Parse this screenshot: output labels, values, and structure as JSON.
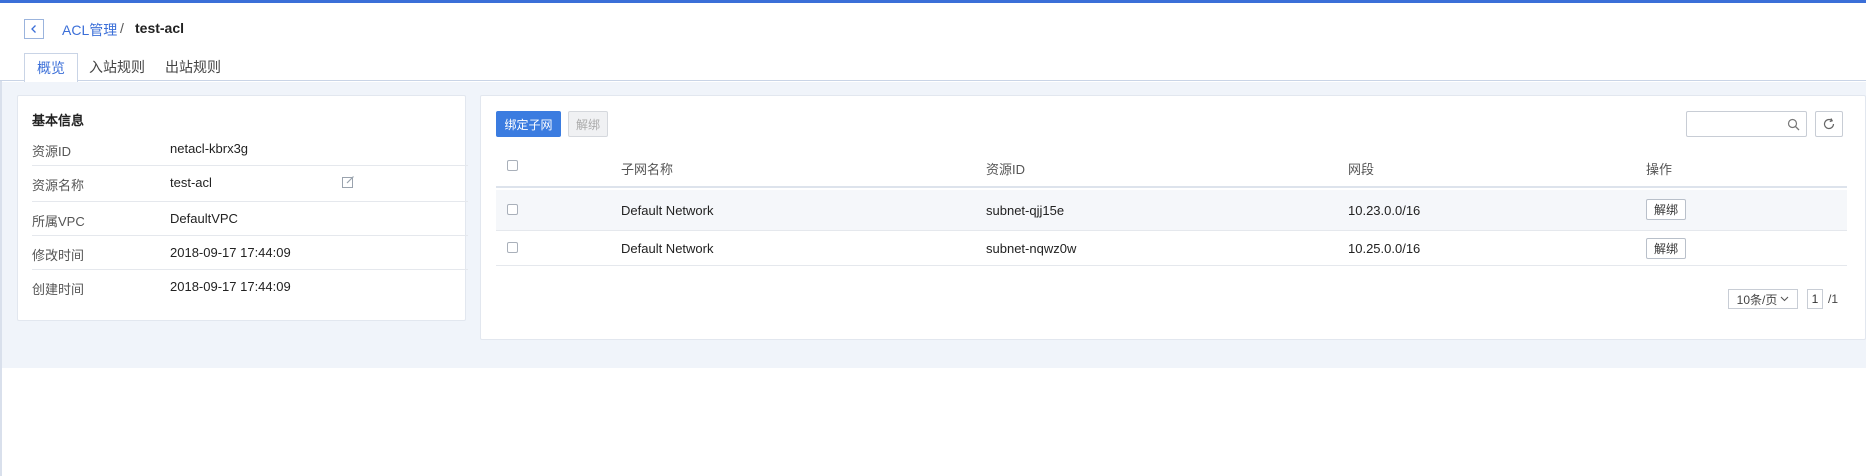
{
  "breadcrumb": {
    "parent": "ACL管理",
    "separator": "/",
    "current": "test-acl"
  },
  "tabs": [
    {
      "label": "概览",
      "active": true
    },
    {
      "label": "入站规则",
      "active": false
    },
    {
      "label": "出站规则",
      "active": false
    }
  ],
  "info": {
    "title": "基本信息",
    "rows": [
      {
        "label": "资源ID",
        "value": "netacl-kbrx3g"
      },
      {
        "label": "资源名称",
        "value": "test-acl"
      },
      {
        "label": "所属VPC",
        "value": "DefaultVPC"
      },
      {
        "label": "修改时间",
        "value": "2018-09-17 17:44:09"
      },
      {
        "label": "创建时间",
        "value": "2018-09-17 17:44:09"
      }
    ]
  },
  "toolbar": {
    "bind_label": "绑定子网",
    "unbind_label": "解绑",
    "search_placeholder": ""
  },
  "table": {
    "columns": [
      "子网名称",
      "资源ID",
      "网段",
      "操作"
    ],
    "rows": [
      {
        "name": "Default Network",
        "id": "subnet-qjj15e",
        "segment": "10.23.0.0/16",
        "action": "解绑"
      },
      {
        "name": "Default Network",
        "id": "subnet-nqwz0w",
        "segment": "10.25.0.0/16",
        "action": "解绑"
      }
    ]
  },
  "pagination": {
    "page_size": "10条/页",
    "current_page": "1",
    "total": "/1"
  },
  "colors": {
    "accent": "#3b6fd8",
    "primary_button": "#3b7ce0",
    "background": "#f0f4fa"
  },
  "icons": {
    "back": "chevron-left-icon",
    "edit": "edit-icon",
    "search": "search-icon",
    "refresh": "refresh-icon",
    "dropdown": "chevron-down-icon"
  }
}
